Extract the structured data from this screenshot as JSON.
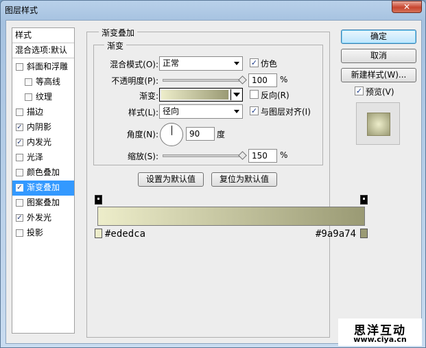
{
  "window": {
    "title": "图层样式",
    "close_label": "✕"
  },
  "styles_list": {
    "header": "样式",
    "blend_default": "混合选项:默认",
    "items": [
      {
        "label": "斜面和浮雕",
        "checked": false,
        "indent": false,
        "selected": false
      },
      {
        "label": "等高线",
        "checked": false,
        "indent": true,
        "selected": false
      },
      {
        "label": "纹理",
        "checked": false,
        "indent": true,
        "selected": false
      },
      {
        "label": "描边",
        "checked": false,
        "indent": false,
        "selected": false
      },
      {
        "label": "内阴影",
        "checked": true,
        "indent": false,
        "selected": false
      },
      {
        "label": "内发光",
        "checked": true,
        "indent": false,
        "selected": false
      },
      {
        "label": "光泽",
        "checked": false,
        "indent": false,
        "selected": false
      },
      {
        "label": "颜色叠加",
        "checked": false,
        "indent": false,
        "selected": false
      },
      {
        "label": "渐变叠加",
        "checked": true,
        "indent": false,
        "selected": true
      },
      {
        "label": "图案叠加",
        "checked": false,
        "indent": false,
        "selected": false
      },
      {
        "label": "外发光",
        "checked": true,
        "indent": false,
        "selected": false
      },
      {
        "label": "投影",
        "checked": false,
        "indent": false,
        "selected": false
      }
    ]
  },
  "panel": {
    "group_title": "渐变叠加",
    "sub_title": "渐变",
    "blend_mode_label": "混合模式(O):",
    "blend_mode_value": "正常",
    "dither_label": "仿色",
    "dither_checked": true,
    "opacity_label": "不透明度(P):",
    "opacity_value": "100",
    "opacity_unit": "%",
    "opacity_level": 1.0,
    "gradient_label": "渐变:",
    "reverse_label": "反向(R)",
    "reverse_checked": false,
    "style_label": "样式(L):",
    "style_value": "径向",
    "align_label": "与图层对齐(I)",
    "align_checked": true,
    "angle_label": "角度(N):",
    "angle_value": "90",
    "angle_unit": "度",
    "scale_label": "缩放(S):",
    "scale_value": "150",
    "scale_unit": "%",
    "scale_level": 1.0,
    "set_default": "设置为默认值",
    "reset_default": "复位为默认值"
  },
  "gradient": {
    "start_color": "#ededca",
    "end_color": "#9a9a74",
    "start_label": "#ededca",
    "end_label": "#9a9a74"
  },
  "buttons": {
    "ok": "确定",
    "cancel": "取消",
    "new_style": "新建样式(W)...",
    "preview_label": "预览(V)",
    "preview_checked": true
  },
  "watermark": {
    "line1": "思洋互动",
    "line2": "www.ciya.cn"
  },
  "colors": {
    "selection": "#3399ff",
    "title_bar": "#b9d1ea"
  }
}
